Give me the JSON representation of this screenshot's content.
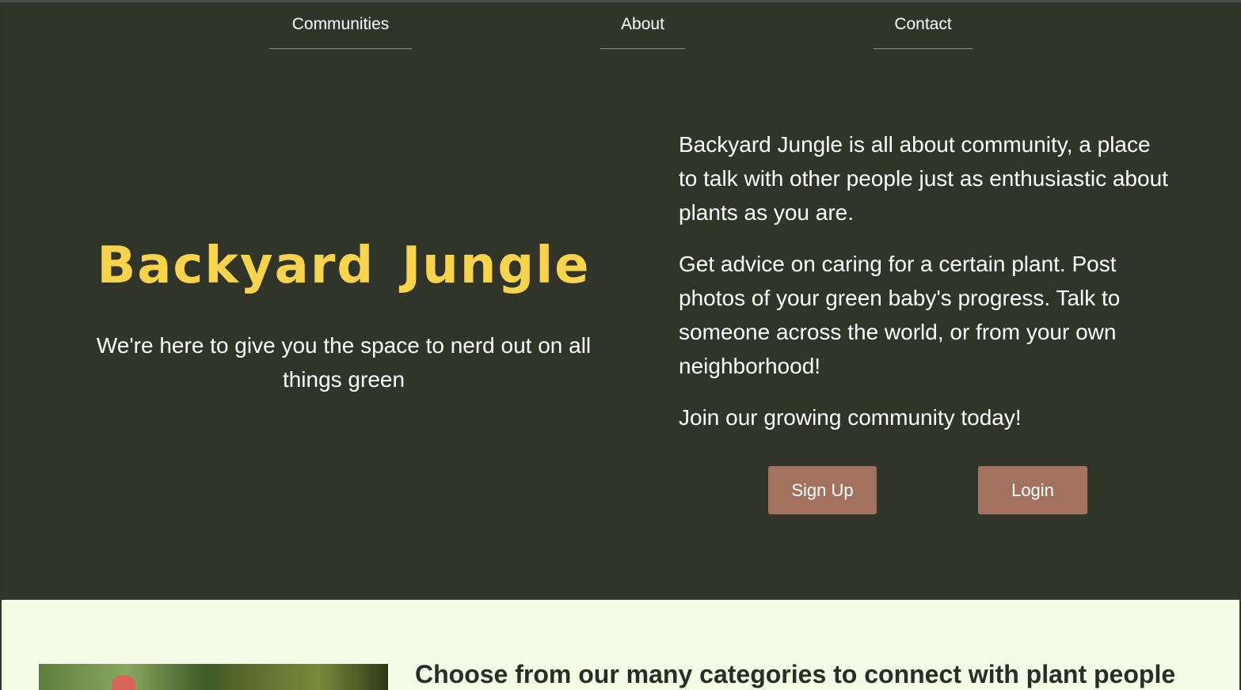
{
  "nav": {
    "communities": "Communities",
    "about": "About",
    "contact": "Contact"
  },
  "hero": {
    "title": "Backyard Jungle",
    "tagline": "We're here to give you the space to nerd out on all things green",
    "about_p1": "Backyard Jungle is all about community, a place to talk with other people just as enthusiastic about plants as you are.",
    "about_p2": "Get advice on caring for a certain plant. Post photos of your green baby's progress. Talk to someone across the world, or from your own neighborhood!",
    "about_p3": "Join our growing community today!",
    "signup_label": "Sign Up",
    "login_label": "Login"
  },
  "lower": {
    "categories_text": "Choose from our many categories to connect with plant people"
  },
  "colors": {
    "hero_bg": "#313428",
    "title": "#f7d44c",
    "button": "#a2725e",
    "lower_bg": "#f4fbe6"
  }
}
